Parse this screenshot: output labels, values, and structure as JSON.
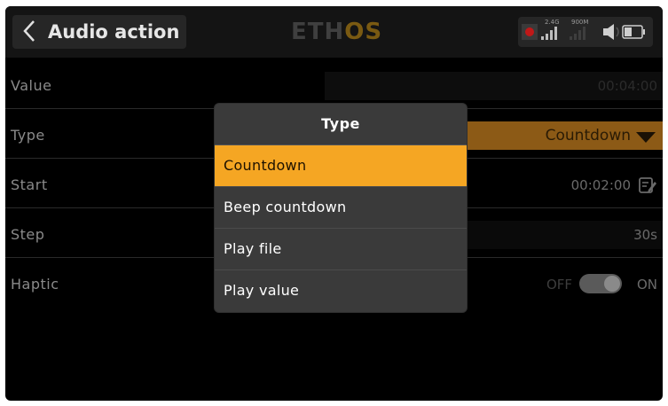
{
  "header": {
    "title": "Audio action",
    "logo_prefix": "ETH",
    "logo_suffix": "OS",
    "radio_band": "2.4G",
    "rf_band": "900M"
  },
  "rows": [
    {
      "label": "Value",
      "value": "00:04:00"
    },
    {
      "label": "Type",
      "value": "Countdown"
    },
    {
      "label": "Start",
      "value": "00:02:00"
    },
    {
      "label": "Step",
      "value": "30s"
    },
    {
      "label": "Haptic",
      "off_label": "OFF",
      "on_label": "ON",
      "state": "on"
    }
  ],
  "popup": {
    "title": "Type",
    "options": [
      "Countdown",
      "Beep countdown",
      "Play file",
      "Play value"
    ],
    "selected_index": 0
  },
  "colors": {
    "accent": "#f5a623",
    "dim_accent": "#8c5a16",
    "background": "#000000",
    "popup": "#3a3a3a"
  },
  "icons": [
    "back-icon",
    "edit-icon",
    "record-icon",
    "signal-icon",
    "speaker-icon",
    "battery-icon"
  ]
}
